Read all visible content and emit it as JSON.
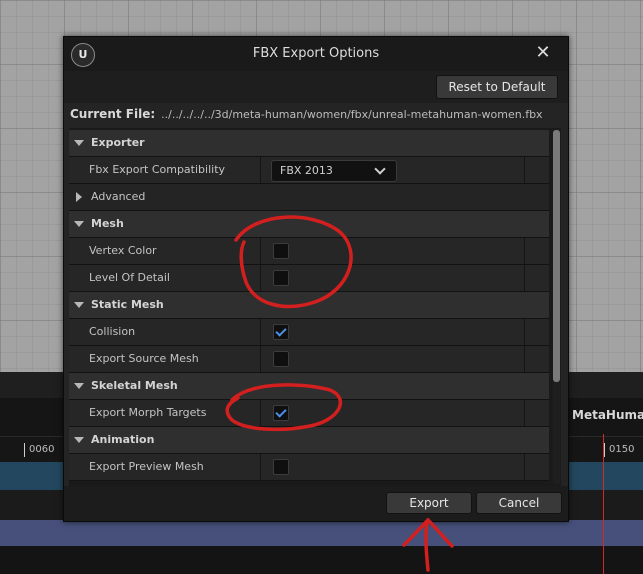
{
  "dialog": {
    "title": "FBX Export Options",
    "logo_icon": "unreal-engine-logo",
    "logo_text": "U",
    "close_glyph": "✕",
    "reset_label": "Reset to Default",
    "current_file_label": "Current File:",
    "current_file_path": "../../../../../3d/meta-human/women/fbx/unreal-metahuman-women.fbx",
    "export_label": "Export",
    "cancel_label": "Cancel"
  },
  "sections": {
    "exporter": "Exporter",
    "advanced": "Advanced",
    "mesh": "Mesh",
    "static_mesh": "Static Mesh",
    "skeletal_mesh": "Skeletal Mesh",
    "animation": "Animation"
  },
  "props": {
    "fbx_compat": {
      "label": "Fbx Export Compatibility",
      "value": "FBX 2013"
    },
    "vertex_color": {
      "label": "Vertex Color",
      "checked": false
    },
    "level_of_detail": {
      "label": "Level Of Detail",
      "checked": false
    },
    "collision": {
      "label": "Collision",
      "checked": true
    },
    "export_source_mesh": {
      "label": "Export Source Mesh",
      "checked": false
    },
    "export_morph_targets": {
      "label": "Export Morph Targets",
      "checked": true
    },
    "export_preview_mesh": {
      "label": "Export Preview Mesh",
      "checked": false
    }
  },
  "sequencer": {
    "track_label": "MetaHuman",
    "tick_left": "0060",
    "tick_right": "0150"
  },
  "colors": {
    "accent_check": "#4a8fe8",
    "annotation_red": "#d41f1f",
    "track_blue": "#23475f",
    "track_purple": "#46507a",
    "playhead": "#d02a2a"
  }
}
